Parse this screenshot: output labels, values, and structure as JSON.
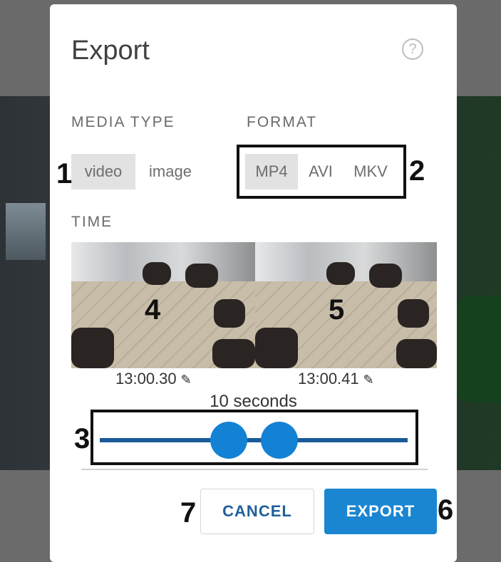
{
  "dialog": {
    "title": "Export",
    "help_icon": "question-circle-icon"
  },
  "media_type": {
    "label": "MEDIA TYPE",
    "options": [
      "video",
      "image"
    ],
    "selected": "video"
  },
  "format": {
    "label": "FORMAT",
    "options": [
      "MP4",
      "AVI",
      "MKV"
    ],
    "selected": "MP4"
  },
  "time": {
    "label": "TIME",
    "start": "13:00.30",
    "end": "13:00.41",
    "duration": "10 seconds",
    "edit_icon": "pencil-icon"
  },
  "buttons": {
    "cancel": "CANCEL",
    "export": "EXPORT"
  },
  "annotations": {
    "n1": "1",
    "n2": "2",
    "n3": "3",
    "n4": "4",
    "n5": "5",
    "n6": "6",
    "n7": "7"
  },
  "colors": {
    "accent": "#1a86d1",
    "slider_track": "#1a5a99",
    "segment_active": "#e2e2e2"
  }
}
